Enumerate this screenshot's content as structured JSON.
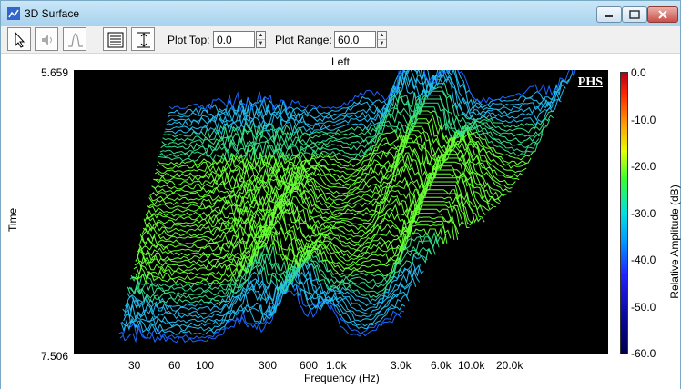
{
  "window": {
    "title": "3D Surface"
  },
  "toolbar": {
    "plot_top_label": "Plot Top:",
    "plot_top_value": "0.0",
    "plot_range_label": "Plot Range:",
    "plot_range_value": "60.0"
  },
  "plot": {
    "channel_label": "Left",
    "watermark": "PHS",
    "y_axis_label": "Time",
    "y_top": "5.659",
    "y_bottom": "7.506",
    "x_axis_label": "Frequency (Hz)",
    "x_ticks": [
      "30",
      "60",
      "100",
      "300",
      "600",
      "1.0k",
      "3.0k",
      "6.0k",
      "10.0k",
      "20.0k"
    ],
    "colorbar_label": "Relative Amplitude (dB)",
    "colorbar_ticks": [
      "0.0",
      "-10.0",
      "-20.0",
      "-30.0",
      "-40.0",
      "-50.0",
      "-60.0"
    ]
  },
  "colors": {
    "background": "#000000",
    "accent_low": "#1a1aff",
    "accent_high": "#33ff33"
  }
}
